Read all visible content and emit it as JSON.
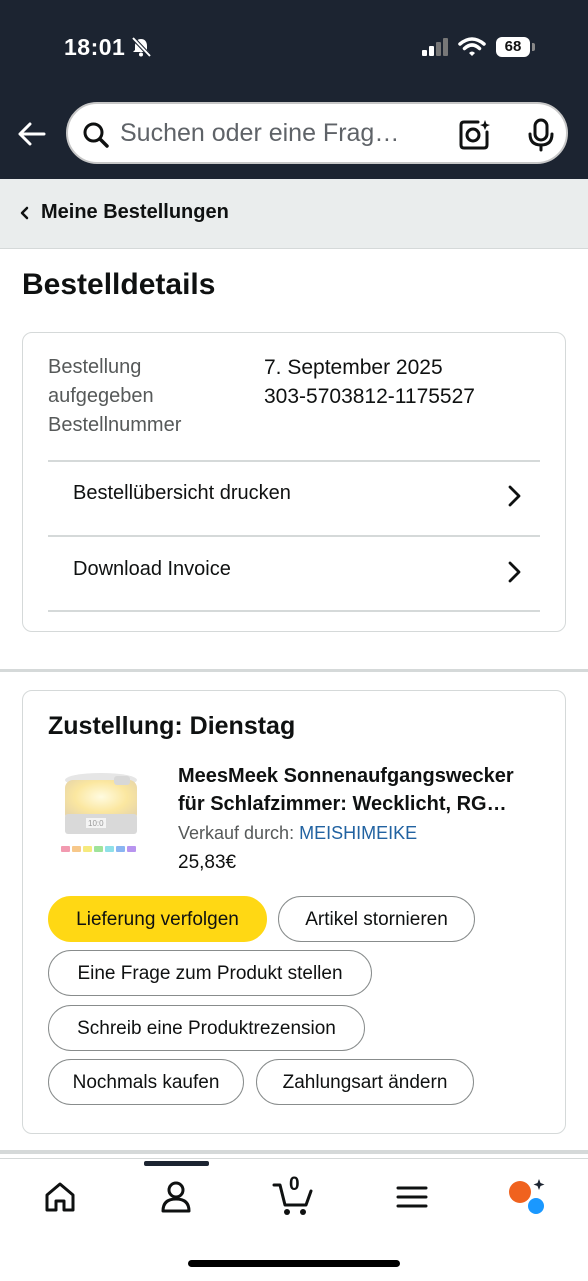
{
  "status_bar": {
    "time": "18:01",
    "battery": "68"
  },
  "search": {
    "placeholder": "Suchen oder eine Frag…"
  },
  "breadcrumb": {
    "label": "Meine Bestellungen"
  },
  "page": {
    "title": "Bestelldetails"
  },
  "order_info": {
    "placed_label_line1": "Bestellung",
    "placed_label_line2": "aufgegeben",
    "number_label": "Bestellnummer",
    "date": "7. September 2025",
    "number": "303-5703812-1175527",
    "links": [
      {
        "label": "Bestellübersicht drucken"
      },
      {
        "label": "Download Invoice"
      }
    ]
  },
  "delivery": {
    "title": "Zustellung: Dienstag",
    "product": {
      "title_line1": "MeesMeek Sonnenaufgangswecker",
      "title_line2": "für Schlafzimmer: Wecklicht, RG…",
      "seller_prefix": "Verkauf durch: ",
      "seller_name": "MEISHIMEIKE",
      "price": "25,83€"
    },
    "actions": {
      "track": "Lieferung verfolgen",
      "cancel": "Artikel stornieren",
      "question": "Eine Frage zum Produkt stellen",
      "review": "Schreib eine Produktrezension",
      "buy_again": "Nochmals kaufen",
      "payment": "Zahlungsart ändern"
    }
  },
  "bottom_nav": {
    "cart_count": "0",
    "items": [
      "home-icon",
      "account-icon",
      "cart-icon",
      "menu-icon",
      "rufus-icon"
    ]
  },
  "colors": {
    "header_bg": "#1c2431",
    "primary_button": "#ffd814",
    "link": "#2162a1"
  }
}
